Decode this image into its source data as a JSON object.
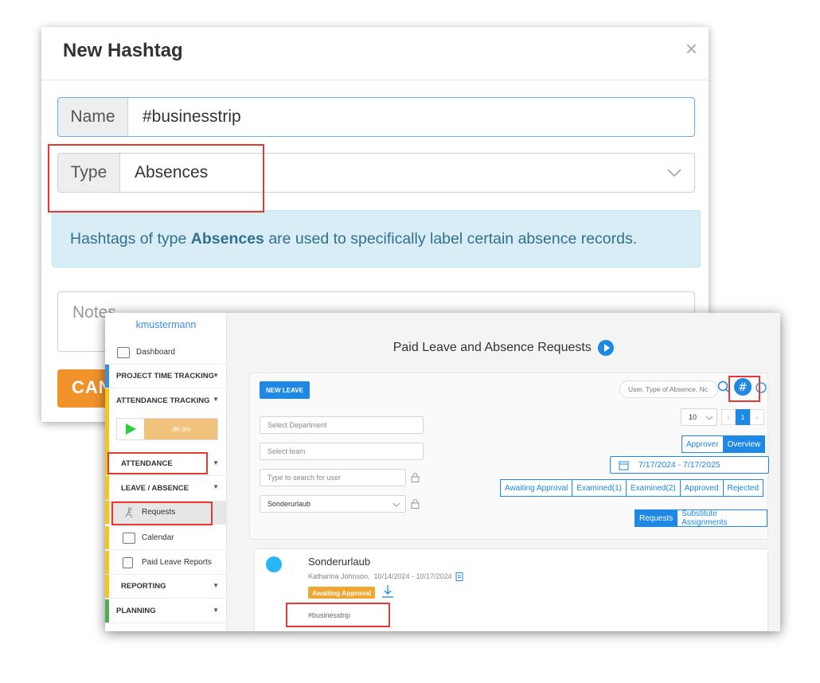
{
  "modal": {
    "title": "New Hashtag",
    "close": "×",
    "name_label": "Name",
    "name_value": "#businesstrip",
    "type_label": "Type",
    "type_value": "Absences",
    "info_prefix": "Hashtags of type ",
    "info_bold": "Absences",
    "info_suffix": " are used to specifically label certain absence records.",
    "notes_placeholder": "Notes",
    "cancel_label": "CAN"
  },
  "sidebar": {
    "username": "kmustermann",
    "dashboard": "Dashboard",
    "project_time": "PROJECT TIME TRACKING",
    "attendance_tracking": "ATTENDANCE TRACKING",
    "timer": "-8h 0m",
    "attendance": "ATTENDANCE",
    "leave_absence": "LEAVE / ABSENCE",
    "requests": "Requests",
    "calendar": "Calendar",
    "paid_leave_reports": "Paid Leave Reports",
    "reporting": "REPORTING",
    "planning": "PLANNING"
  },
  "main": {
    "title": "Paid Leave and Absence Requests",
    "new_leave": "NEW LEAVE",
    "search_placeholder": "User, Type of Absence, Nc",
    "select_department": "Select Department",
    "select_team": "Select team",
    "search_user": "Type to search for user",
    "absence_type": "Sonderurlaub",
    "page_size": "10",
    "page_prev": "‹",
    "page_current": "1",
    "page_next": "›",
    "view_approver": "Approver",
    "view_overview": "Overview",
    "date_range": "7/17/2024 - 7/17/2025",
    "status_filters": [
      "Awaiting Approval",
      "Examined(1)",
      "Examined(2)",
      "Approved",
      "Rejected"
    ],
    "tab_requests": "Requests",
    "tab_substitute": "Substitute Assignments"
  },
  "card": {
    "title": "Sonderurlaub",
    "meta": "Katharina Johnson,  10/14/2024 - 10/17/2024",
    "status": "Awaiting Approval",
    "hashtag": "#businesstrip"
  },
  "colors": {
    "primary": "#1e88e5",
    "warning": "#f0932b",
    "highlight": "#e53935",
    "info_bg": "#d9edf7"
  }
}
